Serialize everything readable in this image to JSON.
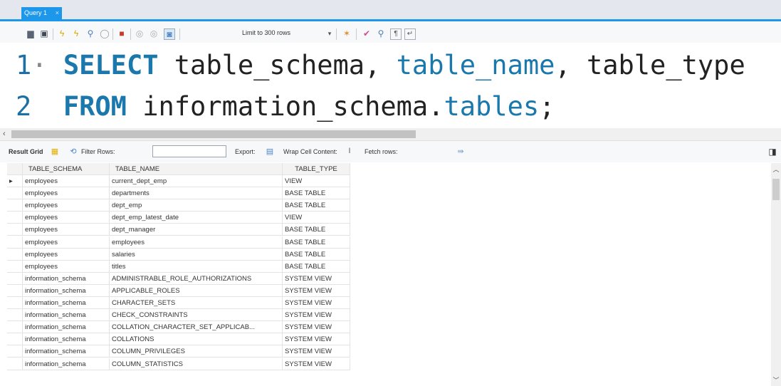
{
  "tab": {
    "label": "Query 1",
    "close": "×"
  },
  "toolbar": {
    "limit_select": "Limit to 300 rows",
    "icons": [
      "folder-icon",
      "save-icon",
      "execute-icon",
      "execute-current-icon",
      "explain-icon",
      "stop-icon",
      "toggle-error-icon",
      "commit-icon",
      "rollback-icon",
      "autocommit-icon",
      "beautify-icon",
      "find-icon",
      "invisible-chars-icon",
      "wrap-icon"
    ]
  },
  "editor": {
    "lines": [
      {
        "num": "1",
        "marker": "·",
        "kw": "SELECT",
        "rest_a": " table_schema, ",
        "hl": "table_name",
        "rest_b": ", table_type"
      },
      {
        "num": "2",
        "marker": " ",
        "kw": "FROM",
        "rest_a": " information_schema.",
        "hl": "tables",
        "rest_b": ";"
      }
    ]
  },
  "result_toolbar": {
    "result_grid": "Result Grid",
    "filter_rows": "Filter Rows:",
    "filter_value": "",
    "export": "Export:",
    "wrap": "Wrap Cell Content:",
    "fetch": "Fetch rows:"
  },
  "grid": {
    "columns": [
      "TABLE_SCHEMA",
      "TABLE_NAME",
      "TABLE_TYPE"
    ],
    "current_row_marker": "▸",
    "rows": [
      [
        "employees",
        "current_dept_emp",
        "VIEW"
      ],
      [
        "employees",
        "departments",
        "BASE TABLE"
      ],
      [
        "employees",
        "dept_emp",
        "BASE TABLE"
      ],
      [
        "employees",
        "dept_emp_latest_date",
        "VIEW"
      ],
      [
        "employees",
        "dept_manager",
        "BASE TABLE"
      ],
      [
        "employees",
        "employees",
        "BASE TABLE"
      ],
      [
        "employees",
        "salaries",
        "BASE TABLE"
      ],
      [
        "employees",
        "titles",
        "BASE TABLE"
      ],
      [
        "information_schema",
        "ADMINISTRABLE_ROLE_AUTHORIZATIONS",
        "SYSTEM VIEW"
      ],
      [
        "information_schema",
        "APPLICABLE_ROLES",
        "SYSTEM VIEW"
      ],
      [
        "information_schema",
        "CHARACTER_SETS",
        "SYSTEM VIEW"
      ],
      [
        "information_schema",
        "CHECK_CONSTRAINTS",
        "SYSTEM VIEW"
      ],
      [
        "information_schema",
        "COLLATION_CHARACTER_SET_APPLICAB...",
        "SYSTEM VIEW"
      ],
      [
        "information_schema",
        "COLLATIONS",
        "SYSTEM VIEW"
      ],
      [
        "information_schema",
        "COLUMN_PRIVILEGES",
        "SYSTEM VIEW"
      ],
      [
        "information_schema",
        "COLUMN_STATISTICS",
        "SYSTEM VIEW"
      ]
    ]
  },
  "colors": {
    "accent": "#1c97ea",
    "keyword": "#1a78ac"
  }
}
